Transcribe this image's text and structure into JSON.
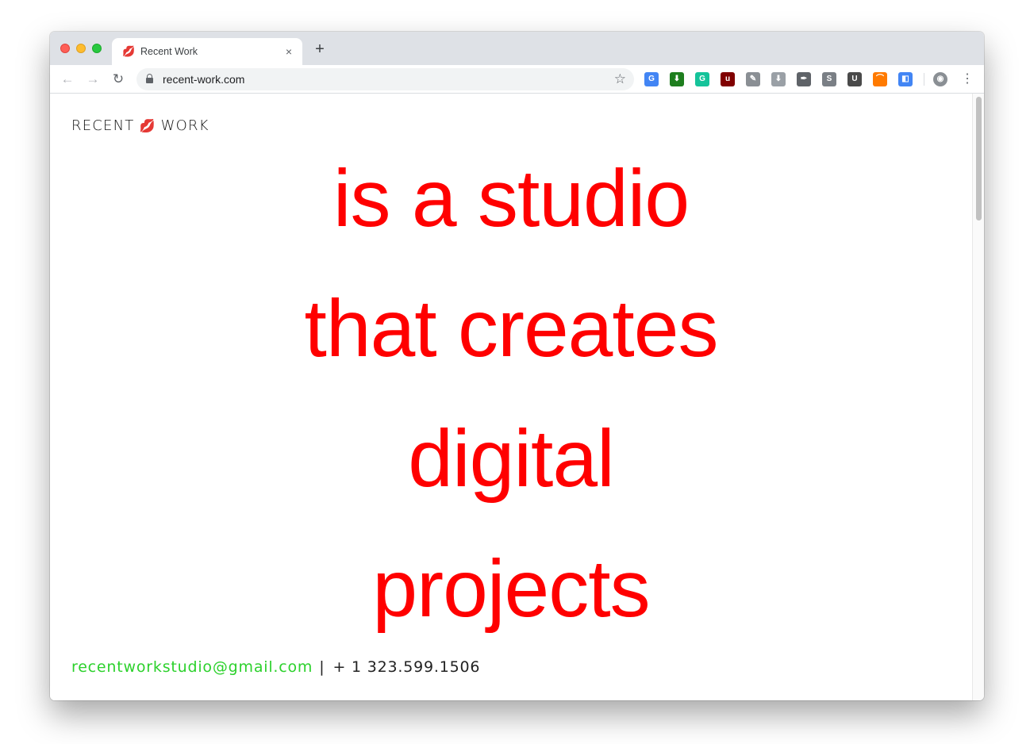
{
  "browser": {
    "tab": {
      "title": "Recent Work",
      "favicon": "lips-icon",
      "close": "×"
    },
    "new_tab": "+",
    "nav": {
      "back": "←",
      "forward": "→",
      "reload": "↻"
    },
    "url": "recent-work.com",
    "bookmark": "☆",
    "extensions": [
      {
        "name": "google-translate-icon",
        "label": "G",
        "color": "#4285f4"
      },
      {
        "name": "download-arrow-icon",
        "label": "⬇",
        "color": "#1e7e1e"
      },
      {
        "name": "grammarly-icon",
        "label": "G",
        "color": "#15c39a"
      },
      {
        "name": "ublock-icon",
        "label": "u",
        "color": "#800000"
      },
      {
        "name": "pin-icon",
        "label": "✎",
        "color": "#8a8f94"
      },
      {
        "name": "download-gray-icon",
        "label": "⬇",
        "color": "#9aa0a6"
      },
      {
        "name": "pen-icon",
        "label": "✒",
        "color": "#5f6368"
      },
      {
        "name": "skype-icon",
        "label": "S",
        "color": "#7a7f85"
      },
      {
        "name": "u-box-icon",
        "label": "U",
        "color": "#4a4a4a"
      },
      {
        "name": "rainbow-icon",
        "label": "⌒",
        "color": "#ff7a00"
      },
      {
        "name": "devtools-icon",
        "label": "◧",
        "color": "#4285f4"
      }
    ],
    "profile_icon": "profile-icon",
    "menu": "⋮"
  },
  "page": {
    "logo": {
      "left": "RECENT",
      "right": "WORK",
      "emoji": "💋"
    },
    "headline": [
      "is a studio",
      "that creates",
      "digital",
      "projects"
    ],
    "footer": {
      "email": "recentworkstudio@gmail.com",
      "separator": "|",
      "phone": "+ 1 323.599.1506"
    },
    "colors": {
      "headline": "#ff0000",
      "email": "#2cd12c"
    }
  }
}
